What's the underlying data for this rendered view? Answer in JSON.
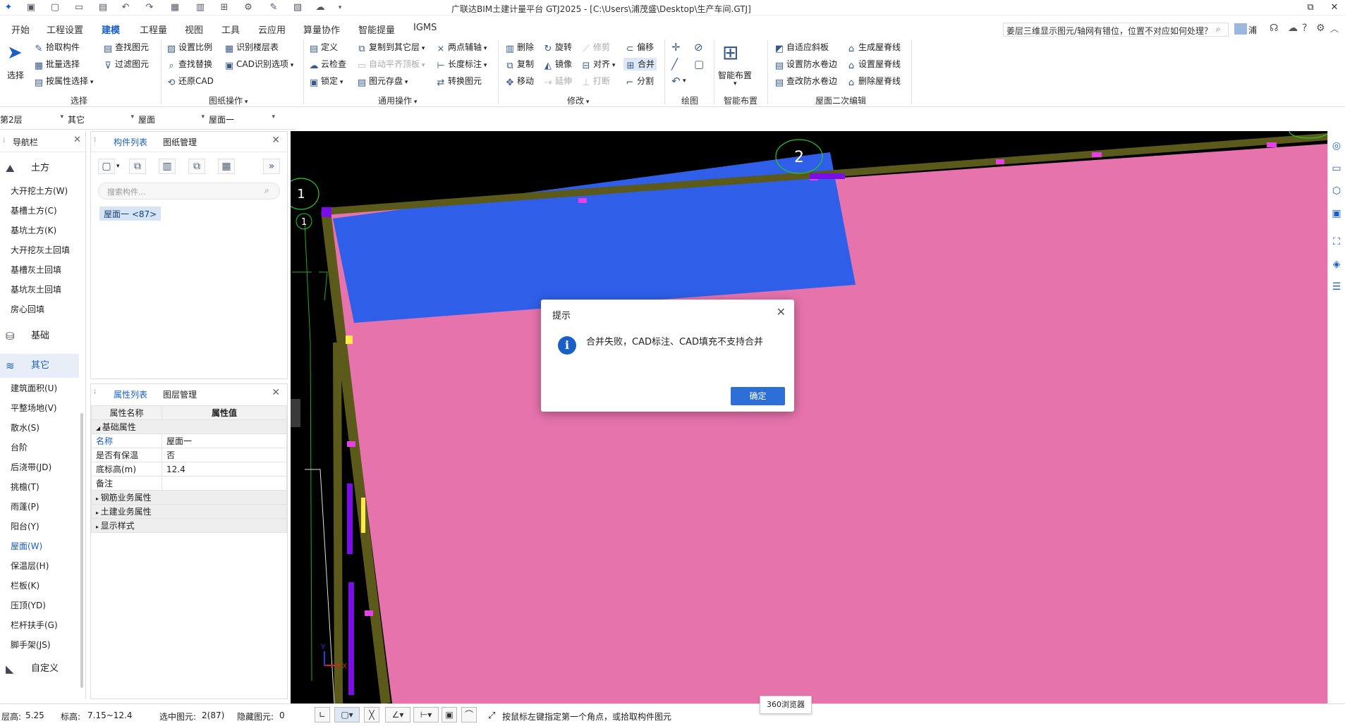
{
  "window": {
    "title": "广联达BIM土建计量平台 GTJ2025 - [C:\\Users\\浦茂盛\\Desktop\\生产车间.GTJ]",
    "restore_glyph": "⧉",
    "close_glyph": "✕"
  },
  "quick_access_icons": [
    "app-logo-icon",
    "new-file-icon",
    "new-icon",
    "open-folder-icon",
    "save-icon",
    "undo-icon",
    "redo-icon",
    "calc-icon",
    "floor-icon",
    "grid-icon",
    "tools-icon",
    "pen-icon",
    "ruler-icon",
    "cloud-sync-icon",
    "more-dropdown-icon"
  ],
  "menu": [
    "开始",
    "工程设置",
    "建模",
    "工程量",
    "视图",
    "工具",
    "云应用",
    "算量协作",
    "智能提量",
    "IGMS"
  ],
  "menu_active": "建模",
  "search": {
    "text": "姜层三维显示图元/轴网有错位，位置不对应如何处理？"
  },
  "user_short": "浦",
  "ribbon": {
    "select": {
      "label": "选择",
      "items": [
        "拾取构件",
        "批量选择",
        "按属性选择"
      ],
      "group": "选择"
    },
    "find": {
      "items": [
        "查找图元",
        "过滤图元"
      ]
    },
    "drawing_ops": {
      "items": [
        "设置比例",
        "识别楼层表",
        "查找替换",
        "CAD识别选项",
        "还原CAD"
      ],
      "group": "图纸操作"
    },
    "common_ops": {
      "items": [
        "定义",
        "复制到其它层",
        "两点辅轴",
        "云检查",
        "自动平齐顶板",
        "长度标注",
        "锁定",
        "图元存盘",
        "转换图元"
      ],
      "group": "通用操作"
    },
    "modify": {
      "items": [
        "删除",
        "旋转",
        "修剪",
        "偏移",
        "复制",
        "镜像",
        "对齐",
        "合并",
        "移动",
        "延伸",
        "打断",
        "分割"
      ],
      "group": "修改"
    },
    "draw": {
      "group": "绘图"
    },
    "smart": {
      "label": "智能布置",
      "group": "智能布置"
    },
    "roof": {
      "items": [
        "自适应斜板",
        "生成屋脊线",
        "设置防水卷边",
        "设置屋脊线",
        "查改防水卷边",
        "删除屋脊线"
      ],
      "group": "屋面二次编辑"
    }
  },
  "floor_selectors": [
    "第2层",
    "其它",
    "屋面",
    "屋面一"
  ],
  "nav": {
    "title": "导航栏",
    "categories": {
      "earth": "土方",
      "foundation": "基础",
      "other": "其它",
      "custom": "自定义"
    },
    "earth_items": [
      "大开挖土方(W)",
      "基槽土方(C)",
      "基坑土方(K)",
      "大开挖灰土回填",
      "基槽灰土回填",
      "基坑灰土回填",
      "房心回填"
    ],
    "other_items": [
      "建筑面积(U)",
      "平整场地(V)",
      "散水(S)",
      "台阶",
      "后浇带(JD)",
      "挑檐(T)",
      "雨蓬(P)",
      "阳台(Y)",
      "屋面(W)",
      "保温层(H)",
      "栏板(K)",
      "压顶(YD)",
      "栏杆扶手(G)",
      "脚手架(JS)"
    ],
    "active_item": "屋面(W)"
  },
  "component_panel": {
    "tabs": [
      "构件列表",
      "图纸管理"
    ],
    "search_placeholder": "搜索构件...",
    "selected": "屋面一 <87>"
  },
  "property_panel": {
    "tabs": [
      "属性列表",
      "图层管理"
    ],
    "headers": [
      "属性名称",
      "属性值"
    ],
    "section_basic": "基础属性",
    "rows": [
      {
        "name": "名称",
        "value": "屋面一"
      },
      {
        "name": "是否有保温",
        "value": "否"
      },
      {
        "name": "底标高(m)",
        "value": "12.4"
      },
      {
        "name": "备注",
        "value": ""
      }
    ],
    "sections": [
      "钢筋业务属性",
      "土建业务属性",
      "显示样式"
    ]
  },
  "canvas": {
    "axis_labels": [
      "1",
      "2",
      "1"
    ],
    "roof_blue": "#2f5fe8",
    "roof_pink": "#e673ac",
    "beam_color": "#5c5a1b",
    "accent_purple": "#7a0ee6",
    "coord_x": "X",
    "coord_y": "Y"
  },
  "dialog": {
    "title": "提示",
    "message": "合并失败，CAD标注、CAD填充不支持合并",
    "ok": "确定",
    "info_glyph": "i",
    "close_glyph": "✕"
  },
  "status": {
    "floor_height_label": "层高:",
    "floor_height": "5.25",
    "elevation_label": "标高:",
    "elevation": "7.15~12.4",
    "selected_label": "选中图元:",
    "selected": "2(87)",
    "hidden_label": "隐藏图元:",
    "hidden": "0",
    "hint": "按鼠标左键指定第一个角点，或拾取构件图元"
  },
  "tooltip": "360浏览器"
}
